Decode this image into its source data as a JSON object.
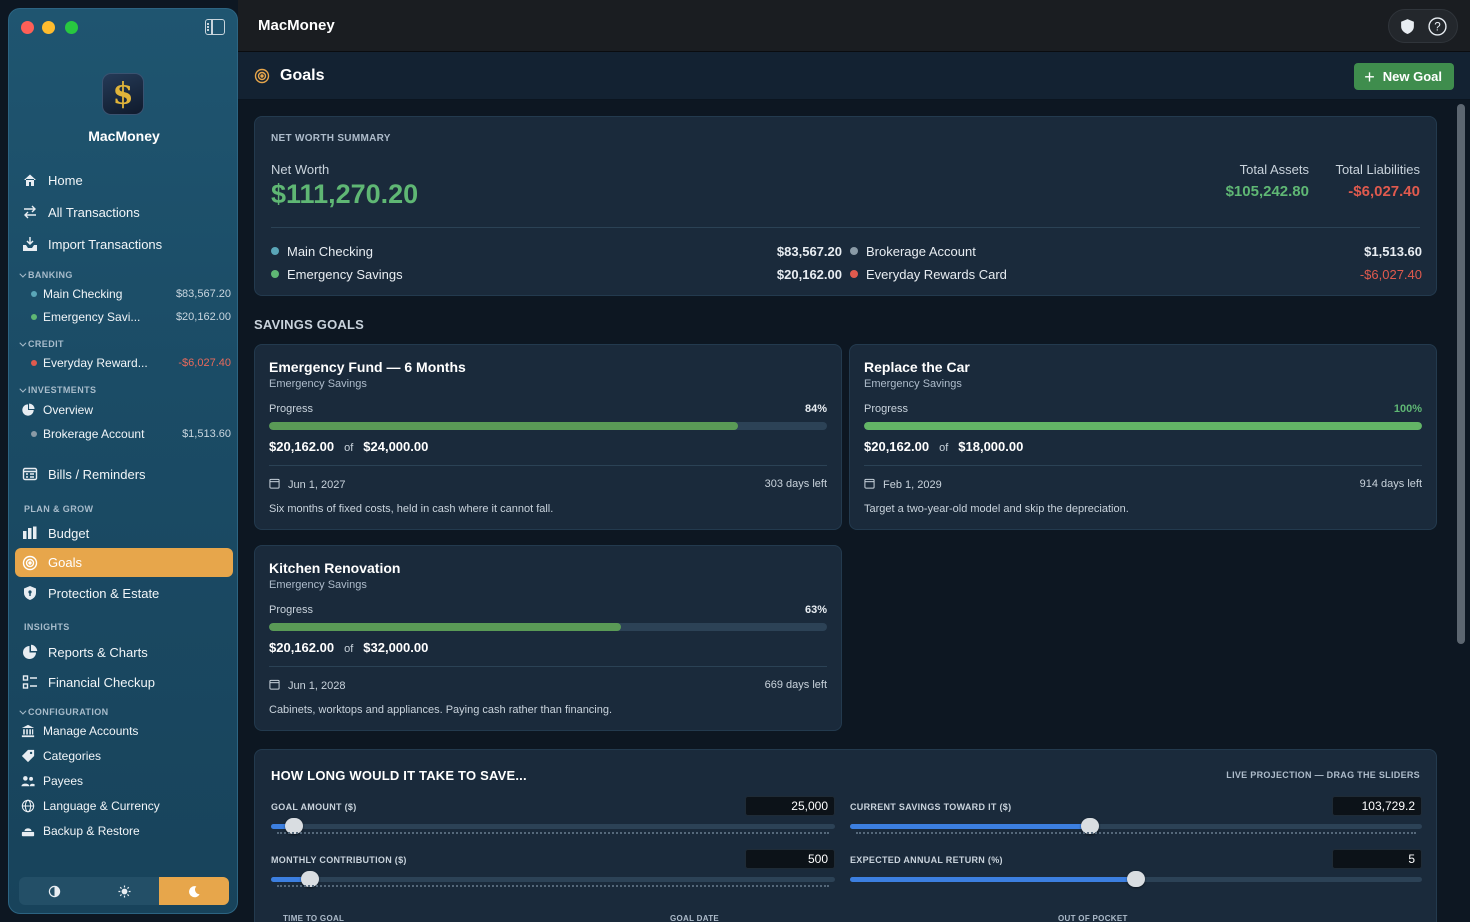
{
  "app": {
    "name": "MacMoney",
    "window_title": "MacMoney"
  },
  "sidebar": {
    "nav": [
      {
        "label": "Home"
      },
      {
        "label": "All Transactions"
      },
      {
        "label": "Import Transactions"
      }
    ],
    "banking": {
      "heading": "BANKING",
      "accounts": [
        {
          "name": "Main Checking",
          "balance": "$83,567.20",
          "color": "#5aa6b8"
        },
        {
          "name": "Emergency Savi...",
          "balance": "$20,162.00",
          "color": "#5fb774"
        }
      ]
    },
    "credit": {
      "heading": "CREDIT",
      "accounts": [
        {
          "name": "Everyday Reward...",
          "balance": "-$6,027.40",
          "color": "#e05a4e"
        }
      ]
    },
    "investments": {
      "heading": "INVESTMENTS",
      "overview": "Overview",
      "accounts": [
        {
          "name": "Brokerage Account",
          "balance": "$1,513.60",
          "color": "#8a9aa6"
        }
      ]
    },
    "bills": "Bills / Reminders",
    "plan_grow": {
      "heading": "PLAN & GROW",
      "items": [
        "Budget",
        "Goals",
        "Protection & Estate"
      ]
    },
    "insights": {
      "heading": "INSIGHTS",
      "items": [
        "Reports & Charts",
        "Financial Checkup"
      ]
    },
    "configuration": {
      "heading": "CONFIGURATION",
      "items": [
        "Manage Accounts",
        "Categories",
        "Payees",
        "Language & Currency",
        "Backup & Restore"
      ]
    },
    "theme": {
      "options": [
        "auto",
        "light",
        "dark"
      ],
      "selected": "dark"
    }
  },
  "header": {
    "title": "Goals",
    "new_goal_label": "New Goal"
  },
  "net_worth": {
    "section_label": "NET WORTH SUMMARY",
    "label": "Net Worth",
    "value": "$111,270.20",
    "total_assets_label": "Total Assets",
    "total_assets": "$105,242.80",
    "total_liabilities_label": "Total Liabilities",
    "total_liabilities": "-$6,027.40",
    "accounts": [
      {
        "name": "Main Checking",
        "value": "$83,567.20",
        "color": "#5aa6b8"
      },
      {
        "name": "Emergency Savings",
        "value": "$20,162.00",
        "color": "#5fb774"
      },
      {
        "name": "Brokerage Account",
        "value": "$1,513.60",
        "color": "#8a9aa6"
      },
      {
        "name": "Everyday Rewards Card",
        "value": "-$6,027.40",
        "color": "#e05a4e"
      }
    ]
  },
  "savings_goals": {
    "title": "SAVINGS GOALS",
    "goals": [
      {
        "title": "Emergency Fund — 6 Months",
        "account": "Emergency Savings",
        "progress_label": "Progress",
        "percent_text": "84%",
        "progress": 0.84,
        "saved": "$20,162.00",
        "of": "of",
        "target": "$24,000.00",
        "date": "Jun 1, 2027",
        "days_left": "303 days left",
        "note": "Six months of fixed costs, held in cash where it cannot fall."
      },
      {
        "title": "Replace the Car",
        "account": "Emergency Savings",
        "progress_label": "Progress",
        "percent_text": "100%",
        "progress": 1.0,
        "saved": "$20,162.00",
        "of": "of",
        "target": "$18,000.00",
        "date": "Feb 1, 2029",
        "days_left": "914 days left",
        "note": "Target a two-year-old model and skip the depreciation."
      },
      {
        "title": "Kitchen Renovation",
        "account": "Emergency Savings",
        "progress_label": "Progress",
        "percent_text": "63%",
        "progress": 0.63,
        "saved": "$20,162.00",
        "of": "of",
        "target": "$32,000.00",
        "date": "Jun 1, 2028",
        "days_left": "669 days left",
        "note": "Cabinets, worktops and appliances. Paying cash rather than financing."
      }
    ]
  },
  "calculator": {
    "title": "HOW LONG WOULD IT TAKE TO SAVE...",
    "hint": "LIVE PROJECTION — DRAG THE SLIDERS",
    "fields": [
      {
        "label": "GOAL AMOUNT ($)",
        "value": "25,000",
        "slider": 0.04
      },
      {
        "label": "CURRENT SAVINGS TOWARD IT ($)",
        "value": "103,729.2",
        "slider": 0.42
      },
      {
        "label": "MONTHLY CONTRIBUTION ($)",
        "value": "500",
        "slider": 0.07
      },
      {
        "label": "EXPECTED ANNUAL RETURN (%)",
        "value": "5",
        "slider": 0.5
      }
    ],
    "results": [
      {
        "label": "TIME TO GOAL"
      },
      {
        "label": "GOAL DATE"
      },
      {
        "label": "OUT OF POCKET"
      }
    ]
  },
  "colors": {
    "accent": "#e7a64b",
    "positive": "#5fb774",
    "negative": "#e05a4e",
    "button": "#3f8d4d",
    "slider": "#3c7fe0"
  }
}
